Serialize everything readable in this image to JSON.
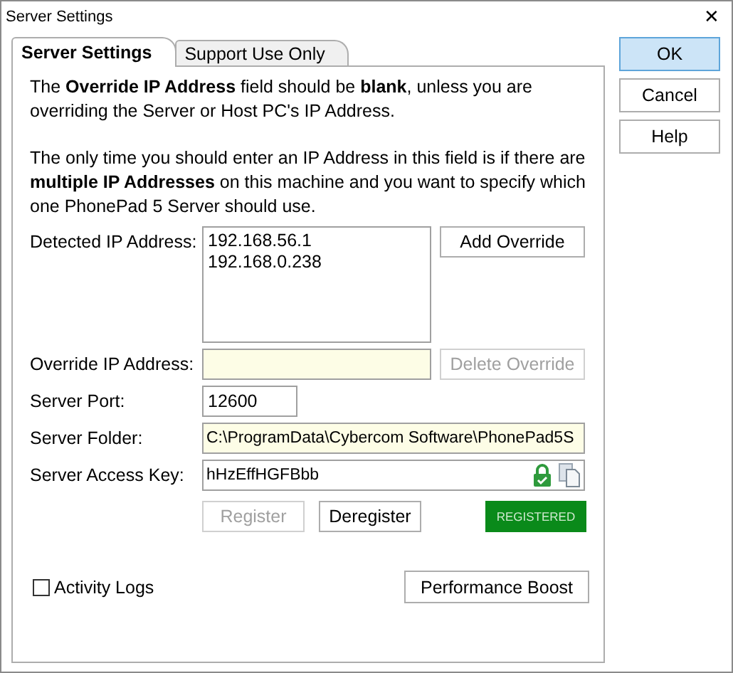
{
  "window": {
    "title": "Server Settings",
    "close": "✕"
  },
  "tabs": [
    {
      "label": "Server Settings",
      "selected": true
    },
    {
      "label": "Support Use Only",
      "selected": false
    }
  ],
  "notes": [
    "The **Override IP Address** field should be **blank**, unless you are overriding the Server or Host PC's IP Address.",
    "The only time you should enter an IP Address in this field is if there are **multiple IP Addresses** on this machine and you want to specify which one PhonePad 5 Server should use."
  ],
  "detected": {
    "label": "Detected IP Address:",
    "items": [
      "192.168.56.1",
      "192.168.0.238"
    ],
    "button": {
      "label": "Add Override",
      "disabled": false
    }
  },
  "override": {
    "label": "Override IP Address:",
    "highlighted": true,
    "button": {
      "label": "Delete Override",
      "disabled": true
    }
  },
  "port": {
    "label": "Server Port:",
    "value": "12600",
    "highlighted": false
  },
  "folder": {
    "label": "Server Folder:",
    "value": "C:\\ProgramData\\Cybercom Software\\PhonePad5S",
    "highlighted": true
  },
  "access_key": {
    "label": "Server Access Key:",
    "value": "hHzEffHGFBbb",
    "highlighted": false
  },
  "register_buttons": [
    {
      "label": "Register",
      "disabled": true
    },
    {
      "label": "Deregister",
      "disabled": false
    }
  ],
  "status": {
    "label": "REGISTERED",
    "registered": true
  },
  "activity_logs": {
    "label": "Activity Logs",
    "checked": false
  },
  "performance_button": {
    "label": "Performance Boost",
    "disabled": false
  },
  "dialog_buttons": [
    {
      "label": "OK",
      "selected": true
    },
    {
      "label": "Cancel",
      "selected": false
    },
    {
      "label": "Help",
      "selected": false
    }
  ]
}
